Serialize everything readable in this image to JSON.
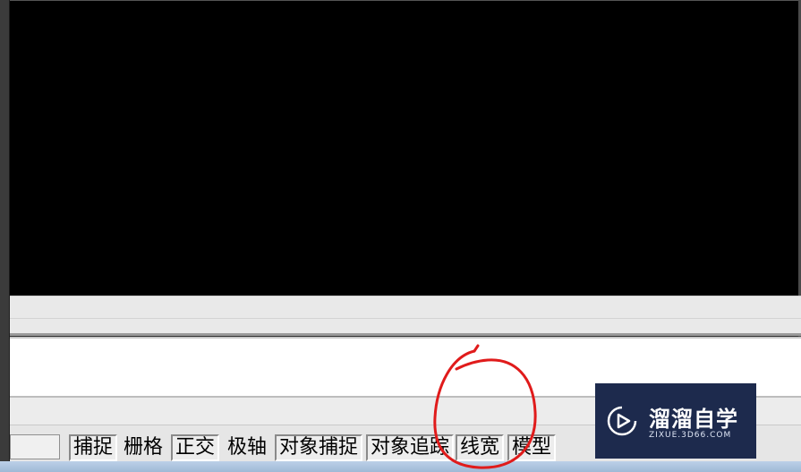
{
  "statusbar": {
    "coordinates": "",
    "buttons": [
      {
        "label": "捕捉",
        "pressed": true
      },
      {
        "label": "栅格",
        "pressed": false
      },
      {
        "label": "正交",
        "pressed": true
      },
      {
        "label": "极轴",
        "pressed": false
      },
      {
        "label": "对象捕捉",
        "pressed": true
      },
      {
        "label": "对象追踪",
        "pressed": true
      },
      {
        "label": "线宽",
        "pressed": true
      },
      {
        "label": "模型",
        "pressed": true
      }
    ]
  },
  "command_line": {
    "text": ""
  },
  "watermark": {
    "brand": "溜溜自学",
    "url": "ZIXUE.3D66.COM",
    "icon": "play-icon",
    "background_color": "#1d2a4d"
  },
  "annotation": {
    "shape": "red-circle",
    "color": "#e01b1b",
    "target": "线宽"
  },
  "colors": {
    "viewport": "#000000",
    "statusbar": "#e6e6e6"
  }
}
